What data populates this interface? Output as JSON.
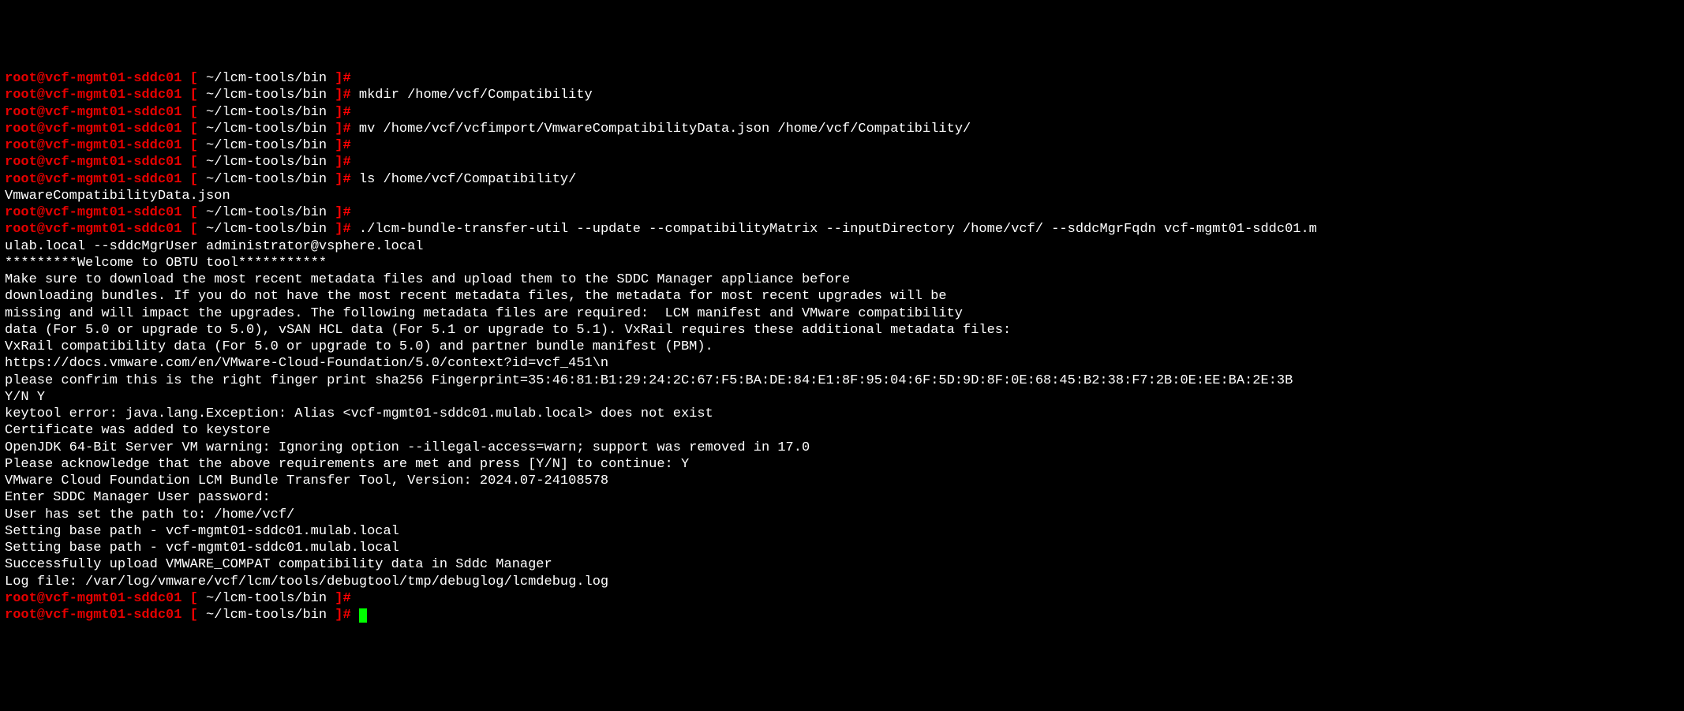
{
  "prompt": {
    "user_host": "root@vcf-mgmt01-sddc01",
    "bracket_open": " [ ",
    "path": "~/lcm-tools/bin",
    "bracket_close": " ]# "
  },
  "lines": [
    {
      "type": "prompt",
      "command": ""
    },
    {
      "type": "prompt",
      "command": "mkdir /home/vcf/Compatibility"
    },
    {
      "type": "prompt",
      "command": ""
    },
    {
      "type": "prompt",
      "command": "mv /home/vcf/vcfimport/VmwareCompatibilityData.json /home/vcf/Compatibility/"
    },
    {
      "type": "prompt",
      "command": ""
    },
    {
      "type": "prompt",
      "command": ""
    },
    {
      "type": "prompt",
      "command": "ls /home/vcf/Compatibility/"
    },
    {
      "type": "output",
      "text": "VmwareCompatibilityData.json"
    },
    {
      "type": "prompt",
      "command": ""
    },
    {
      "type": "prompt",
      "command": "./lcm-bundle-transfer-util --update --compatibilityMatrix --inputDirectory /home/vcf/ --sddcMgrFqdn vcf-mgmt01-sddc01.m"
    },
    {
      "type": "output",
      "text": "ulab.local --sddcMgrUser administrator@vsphere.local"
    },
    {
      "type": "output",
      "text": "*********Welcome to OBTU tool***********"
    },
    {
      "type": "output",
      "text": ""
    },
    {
      "type": "output",
      "text": "Make sure to download the most recent metadata files and upload them to the SDDC Manager appliance before"
    },
    {
      "type": "output",
      "text": "downloading bundles. If you do not have the most recent metadata files, the metadata for most recent upgrades will be"
    },
    {
      "type": "output",
      "text": "missing and will impact the upgrades. The following metadata files are required:  LCM manifest and VMware compatibility"
    },
    {
      "type": "output",
      "text": "data (For 5.0 or upgrade to 5.0), vSAN HCL data (For 5.1 or upgrade to 5.1). VxRail requires these additional metadata files:"
    },
    {
      "type": "output",
      "text": "VxRail compatibility data (For 5.0 or upgrade to 5.0) and partner bundle manifest (PBM)."
    },
    {
      "type": "output",
      "text": "https://docs.vmware.com/en/VMware-Cloud-Foundation/5.0/context?id=vcf_451\\n"
    },
    {
      "type": "output",
      "text": "please confrim this is the right finger print sha256 Fingerprint=35:46:81:B1:29:24:2C:67:F5:BA:DE:84:E1:8F:95:04:6F:5D:9D:8F:0E:68:45:B2:38:F7:2B:0E:EE:BA:2E:3B"
    },
    {
      "type": "output",
      "text": "Y/N Y"
    },
    {
      "type": "output",
      "text": "keytool error: java.lang.Exception: Alias <vcf-mgmt01-sddc01.mulab.local> does not exist"
    },
    {
      "type": "output",
      "text": "Certificate was added to keystore"
    },
    {
      "type": "output",
      "text": "OpenJDK 64-Bit Server VM warning: Ignoring option --illegal-access=warn; support was removed in 17.0"
    },
    {
      "type": "output",
      "text": "Please acknowledge that the above requirements are met and press [Y/N] to continue: Y"
    },
    {
      "type": "output",
      "text": "VMware Cloud Foundation LCM Bundle Transfer Tool, Version: 2024.07-24108578"
    },
    {
      "type": "output",
      "text": "Enter SDDC Manager User password:"
    },
    {
      "type": "output",
      "text": "User has set the path to: /home/vcf/"
    },
    {
      "type": "output",
      "text": "Setting base path - vcf-mgmt01-sddc01.mulab.local"
    },
    {
      "type": "output",
      "text": "Setting base path - vcf-mgmt01-sddc01.mulab.local"
    },
    {
      "type": "output",
      "text": "Successfully upload VMWARE_COMPAT compatibility data in Sddc Manager"
    },
    {
      "type": "output",
      "text": "Log file: /var/log/vmware/vcf/lcm/tools/debugtool/tmp/debuglog/lcmdebug.log"
    },
    {
      "type": "prompt",
      "command": ""
    },
    {
      "type": "prompt",
      "command": "",
      "cursor": true
    }
  ]
}
